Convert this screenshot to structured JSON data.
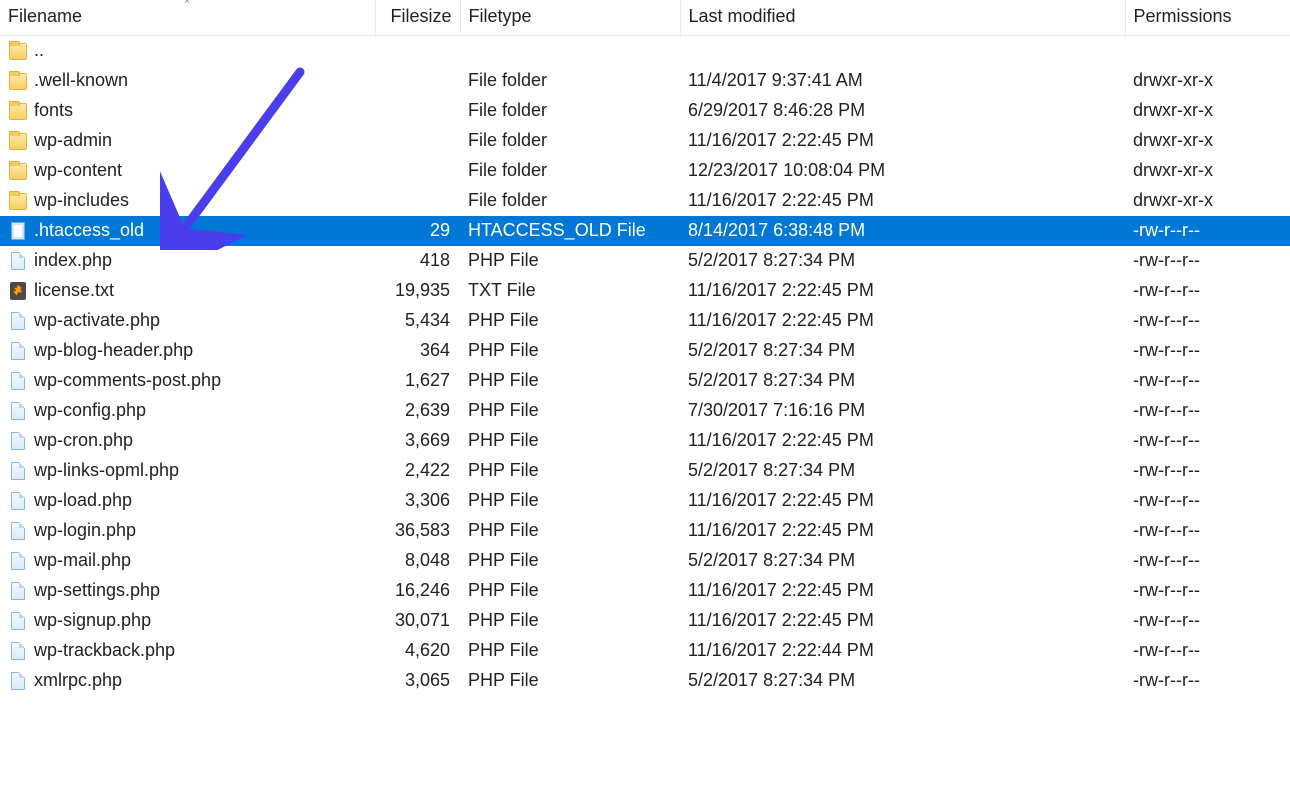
{
  "columns": {
    "filename": "Filename",
    "filesize": "Filesize",
    "filetype": "Filetype",
    "modified": "Last modified",
    "permissions": "Permissions"
  },
  "rows": [
    {
      "icon": "folder",
      "name": "..",
      "size": "",
      "type": "",
      "modified": "",
      "perms": "",
      "selected": false
    },
    {
      "icon": "folder",
      "name": ".well-known",
      "size": "",
      "type": "File folder",
      "modified": "11/4/2017 9:37:41 AM",
      "perms": "drwxr-xr-x",
      "selected": false
    },
    {
      "icon": "folder",
      "name": "fonts",
      "size": "",
      "type": "File folder",
      "modified": "6/29/2017 8:46:28 PM",
      "perms": "drwxr-xr-x",
      "selected": false
    },
    {
      "icon": "folder",
      "name": "wp-admin",
      "size": "",
      "type": "File folder",
      "modified": "11/16/2017 2:22:45 PM",
      "perms": "drwxr-xr-x",
      "selected": false
    },
    {
      "icon": "folder",
      "name": "wp-content",
      "size": "",
      "type": "File folder",
      "modified": "12/23/2017 10:08:04 PM",
      "perms": "drwxr-xr-x",
      "selected": false
    },
    {
      "icon": "folder",
      "name": "wp-includes",
      "size": "",
      "type": "File folder",
      "modified": "11/16/2017 2:22:45 PM",
      "perms": "drwxr-xr-x",
      "selected": false
    },
    {
      "icon": "file",
      "name": ".htaccess_old",
      "size": "29",
      "type": "HTACCESS_OLD File",
      "modified": "8/14/2017 6:38:48 PM",
      "perms": "-rw-r--r--",
      "selected": true
    },
    {
      "icon": "php",
      "name": "index.php",
      "size": "418",
      "type": "PHP File",
      "modified": "5/2/2017 8:27:34 PM",
      "perms": "-rw-r--r--",
      "selected": false
    },
    {
      "icon": "txt",
      "name": "license.txt",
      "size": "19,935",
      "type": "TXT File",
      "modified": "11/16/2017 2:22:45 PM",
      "perms": "-rw-r--r--",
      "selected": false
    },
    {
      "icon": "php",
      "name": "wp-activate.php",
      "size": "5,434",
      "type": "PHP File",
      "modified": "11/16/2017 2:22:45 PM",
      "perms": "-rw-r--r--",
      "selected": false
    },
    {
      "icon": "php",
      "name": "wp-blog-header.php",
      "size": "364",
      "type": "PHP File",
      "modified": "5/2/2017 8:27:34 PM",
      "perms": "-rw-r--r--",
      "selected": false
    },
    {
      "icon": "php",
      "name": "wp-comments-post.php",
      "size": "1,627",
      "type": "PHP File",
      "modified": "5/2/2017 8:27:34 PM",
      "perms": "-rw-r--r--",
      "selected": false
    },
    {
      "icon": "php",
      "name": "wp-config.php",
      "size": "2,639",
      "type": "PHP File",
      "modified": "7/30/2017 7:16:16 PM",
      "perms": "-rw-r--r--",
      "selected": false
    },
    {
      "icon": "php",
      "name": "wp-cron.php",
      "size": "3,669",
      "type": "PHP File",
      "modified": "11/16/2017 2:22:45 PM",
      "perms": "-rw-r--r--",
      "selected": false
    },
    {
      "icon": "php",
      "name": "wp-links-opml.php",
      "size": "2,422",
      "type": "PHP File",
      "modified": "5/2/2017 8:27:34 PM",
      "perms": "-rw-r--r--",
      "selected": false
    },
    {
      "icon": "php",
      "name": "wp-load.php",
      "size": "3,306",
      "type": "PHP File",
      "modified": "11/16/2017 2:22:45 PM",
      "perms": "-rw-r--r--",
      "selected": false
    },
    {
      "icon": "php",
      "name": "wp-login.php",
      "size": "36,583",
      "type": "PHP File",
      "modified": "11/16/2017 2:22:45 PM",
      "perms": "-rw-r--r--",
      "selected": false
    },
    {
      "icon": "php",
      "name": "wp-mail.php",
      "size": "8,048",
      "type": "PHP File",
      "modified": "5/2/2017 8:27:34 PM",
      "perms": "-rw-r--r--",
      "selected": false
    },
    {
      "icon": "php",
      "name": "wp-settings.php",
      "size": "16,246",
      "type": "PHP File",
      "modified": "11/16/2017 2:22:45 PM",
      "perms": "-rw-r--r--",
      "selected": false
    },
    {
      "icon": "php",
      "name": "wp-signup.php",
      "size": "30,071",
      "type": "PHP File",
      "modified": "11/16/2017 2:22:45 PM",
      "perms": "-rw-r--r--",
      "selected": false
    },
    {
      "icon": "php",
      "name": "wp-trackback.php",
      "size": "4,620",
      "type": "PHP File",
      "modified": "11/16/2017 2:22:44 PM",
      "perms": "-rw-r--r--",
      "selected": false
    },
    {
      "icon": "php",
      "name": "xmlrpc.php",
      "size": "3,065",
      "type": "PHP File",
      "modified": "5/2/2017 8:27:34 PM",
      "perms": "-rw-r--r--",
      "selected": false
    }
  ],
  "annotation": {
    "arrow_color": "#4A3DEB"
  }
}
